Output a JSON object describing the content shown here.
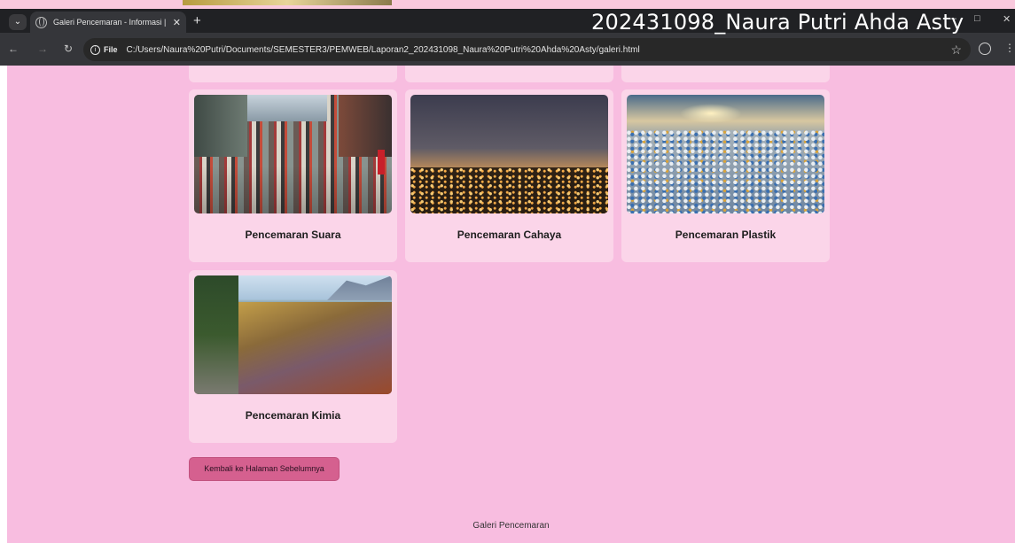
{
  "browser": {
    "tab_title": "Galeri Pencemaran - Informasi |",
    "tab_close": "✕",
    "new_tab": "+",
    "file_label": "File",
    "url": "C:/Users/Naura%20Putri/Documents/SEMESTER3/PEMWEB/Laporan2_202431098_Naura%20Putri%20Ahda%20Asty/galeri.html",
    "window_min": "—",
    "window_restore": "□",
    "window_close": "✕"
  },
  "overlay_name": "202431098_Naura Putri Ahda Asty",
  "gallery": {
    "items": [
      {
        "caption": "Pencemaran Suara",
        "icon": "traffic-photo"
      },
      {
        "caption": "Pencemaran Cahaya",
        "icon": "city-night-photo"
      },
      {
        "caption": "Pencemaran Plastik",
        "icon": "plastic-waste-photo"
      },
      {
        "caption": "Pencemaran Kimia",
        "icon": "polluted-water-photo"
      }
    ]
  },
  "back_button": "Kembali ke Halaman Sebelumnya",
  "footer": "Galeri Pencemaran",
  "colors": {
    "page_bg": "#f8bde0",
    "card_bg": "#fbd5e9",
    "button_bg": "#d5608f"
  }
}
